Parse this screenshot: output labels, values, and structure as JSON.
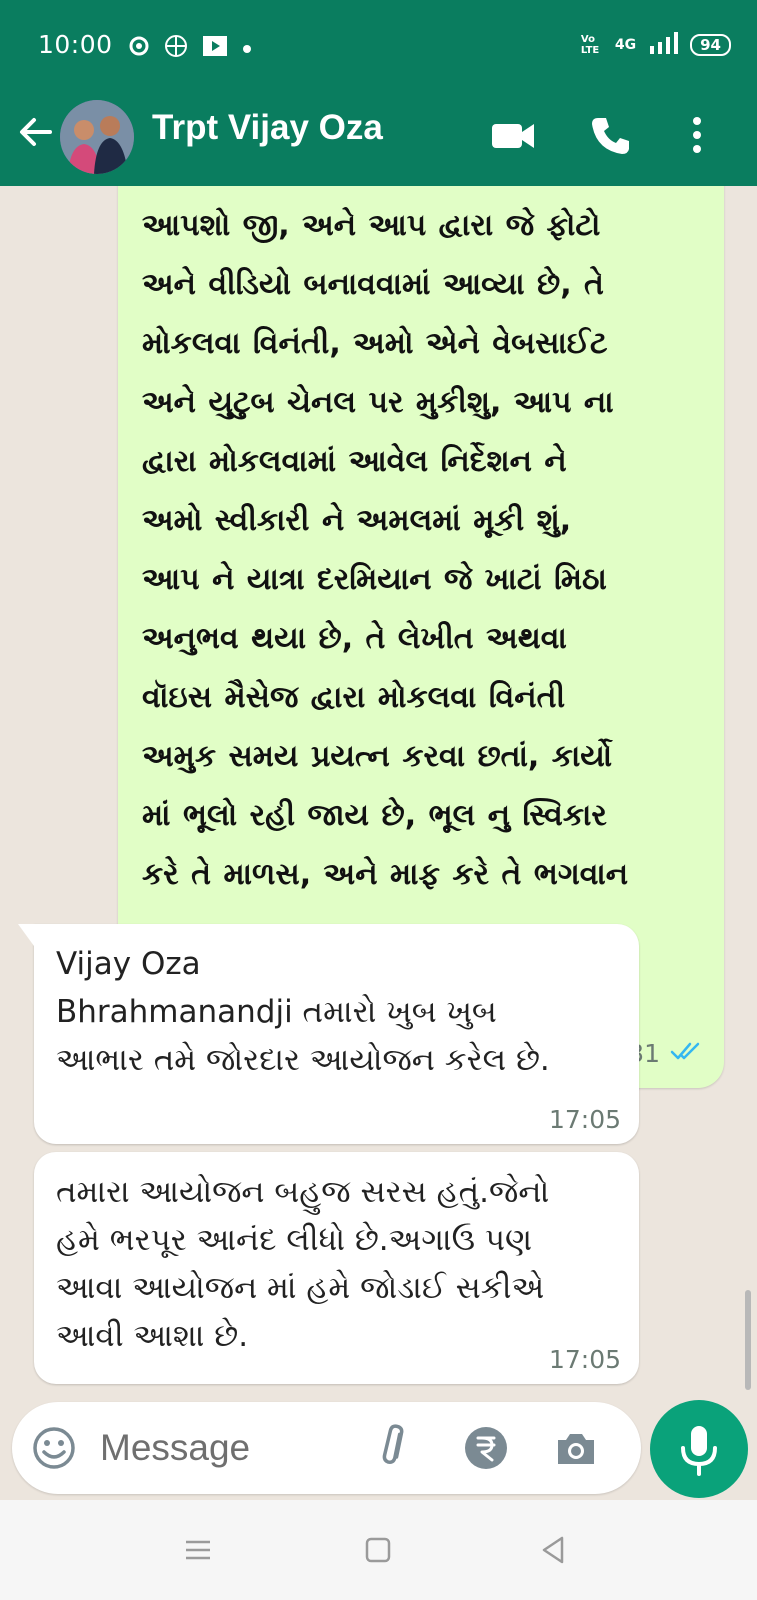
{
  "status_bar": {
    "time": "10:00",
    "network_label": "4G",
    "volte_label": "Vo LTE",
    "battery": "94"
  },
  "header": {
    "contact_name": "Trpt Vijay Oza"
  },
  "messages": [
    {
      "direction": "outgoing",
      "lines": [
        "આપશો જી, અને આપ દ્વારા જે ફોટો",
        "અને વીડિયો બનાવવામાં આવ્યા છે, તે",
        "મોકલવા વિનંતી, અમો એને વેબસાઈટ",
        "અને યુટુબ ચેનલ પર મુકીશુ, આપ ના",
        "દ્વારા મોકલવામાં આવેલ નિર્દેશન ને",
        "અમો સ્વીકારી ને અમલમાં મૂકી શું,",
        "આપ ને યાત્રા દરમિયાન જે ખાટાં મિઠા",
        "અનુભવ થયા છે, તે લેખીત અથવા",
        "વૉઇસ મૈસેજ દ્વારા મોકલવા વિનંતી",
        "અમુક સમય પ્રયત્ન કરવા છતાં, કાર્યો",
        "માં ભૂલો રહી જાય છે, ભૂલ નુ સ્વિકાર",
        "કરે તે માળસ, અને માફ કરે તે ભગવાન"
      ],
      "emojis": "🙏 🙏 🙏 🙏",
      "time": "14:31"
    },
    {
      "direction": "incoming",
      "lines": [
        "Vijay Oza",
        "Bhrahmanandji તમારો ખુબ ખુબ",
        "આભાર તમે જોરદાર આયોજન કરેલ છે."
      ],
      "time": "17:05"
    },
    {
      "direction": "incoming",
      "lines": [
        "તમારા આયોજન બહુજ સરસ હતું.જેનો",
        "હમે ભરપૂર આનંદ લીધો છે.અગાઉ પણ",
        "આવા આયોજન માં હમે જોડાઈ સકીએ",
        "આવી આશા છે."
      ],
      "time": "17:05"
    }
  ],
  "composer": {
    "placeholder": "Message"
  },
  "colors": {
    "brand": "#0a7d5f",
    "outgoing_bubble": "#e1fec6",
    "mic_button": "#0aa27a",
    "read_ticks": "#34b7f1"
  }
}
